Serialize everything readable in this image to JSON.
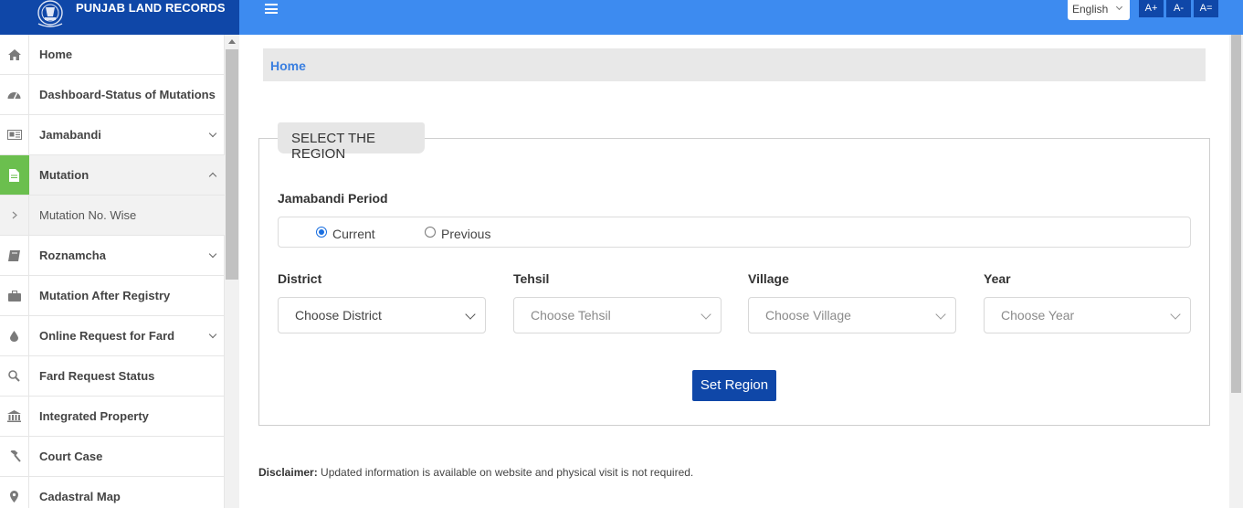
{
  "header": {
    "brand_title": "PUNJAB LAND RECORDS",
    "language": "English",
    "font_controls": [
      "A+",
      "A-",
      "A="
    ],
    "brand_color": "#0f47a8",
    "topbar_color": "#3d8bf0"
  },
  "sidebar": {
    "items": [
      {
        "label": "Home",
        "icon": "home-icon"
      },
      {
        "label": "Dashboard-Status of Mutations",
        "icon": "dashboard-icon"
      },
      {
        "label": "Jamabandi",
        "icon": "newspaper-icon",
        "expandable": true
      },
      {
        "label": "Mutation",
        "icon": "file-icon",
        "expandable": true,
        "expanded": true,
        "active": true
      },
      {
        "label": "Mutation No. Wise",
        "icon": "chevron-right-icon",
        "sub": true
      },
      {
        "label": "Roznamcha",
        "icon": "book-icon",
        "expandable": true
      },
      {
        "label": "Mutation After Registry",
        "icon": "briefcase-icon"
      },
      {
        "label": "Online Request for Fard",
        "icon": "tint-icon",
        "expandable": true
      },
      {
        "label": "Fard Request Status",
        "icon": "search-icon"
      },
      {
        "label": "Integrated Property",
        "icon": "bank-icon"
      },
      {
        "label": "Court Case",
        "icon": "gavel-icon"
      },
      {
        "label": "Cadastral Map",
        "icon": "map-marker-icon"
      }
    ],
    "active_color": "#6bbf4e"
  },
  "breadcrumb": {
    "home": "Home"
  },
  "region": {
    "legend": "SELECT THE REGION",
    "period_label": "Jamabandi Period",
    "period_options": [
      "Current",
      "Previous"
    ],
    "period_selected": "Current",
    "district_label": "District",
    "district_value": "Choose District",
    "tehsil_label": "Tehsil",
    "tehsil_value": "Choose Tehsil",
    "village_label": "Village",
    "village_value": "Choose Village",
    "year_label": "Year",
    "year_value": "Choose Year",
    "set_button": "Set Region"
  },
  "disclaimer": {
    "label": "Disclaimer:",
    "text": " Updated information is available on website and physical visit is not required."
  }
}
